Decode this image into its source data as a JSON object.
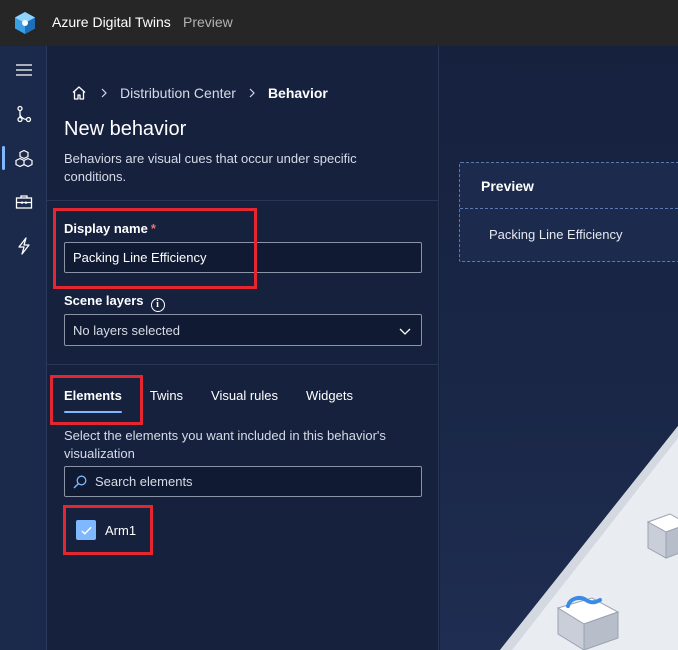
{
  "app": {
    "title": "Azure Digital Twins",
    "subtitle": "Preview",
    "logo_icon": "azure-digital-twins-logo"
  },
  "rail": {
    "items": [
      {
        "icon": "menu-icon",
        "active": false
      },
      {
        "icon": "git-branch-icon",
        "active": false
      },
      {
        "icon": "cubes-icon",
        "active": true
      },
      {
        "icon": "toolbox-icon",
        "active": false
      },
      {
        "icon": "lightning-icon",
        "active": false
      }
    ]
  },
  "breadcrumb": {
    "items": [
      "Distribution Center",
      "Behavior"
    ]
  },
  "page": {
    "title": "New behavior",
    "description": "Behaviors are visual cues that occur under specific conditions."
  },
  "form": {
    "display_name_label": "Display name",
    "required_marker": "*",
    "display_name_value": "Packing Line Efficiency",
    "scene_layers_label": "Scene layers",
    "scene_layers_value": "No layers selected"
  },
  "tabs": [
    {
      "label": "Elements",
      "active": true
    },
    {
      "label": "Twins",
      "active": false
    },
    {
      "label": "Visual rules",
      "active": false
    },
    {
      "label": "Widgets",
      "active": false
    }
  ],
  "elements": {
    "description": "Select the elements you want included in this behavior's visualization",
    "search_placeholder": "Search elements",
    "items": [
      {
        "label": "Arm1",
        "checked": true
      }
    ]
  },
  "preview": {
    "title": "Preview",
    "item": "Packing Line Efficiency"
  },
  "colors": {
    "accent": "#7fb8ff",
    "highlight": "#e3262f",
    "required": "#e57373"
  }
}
